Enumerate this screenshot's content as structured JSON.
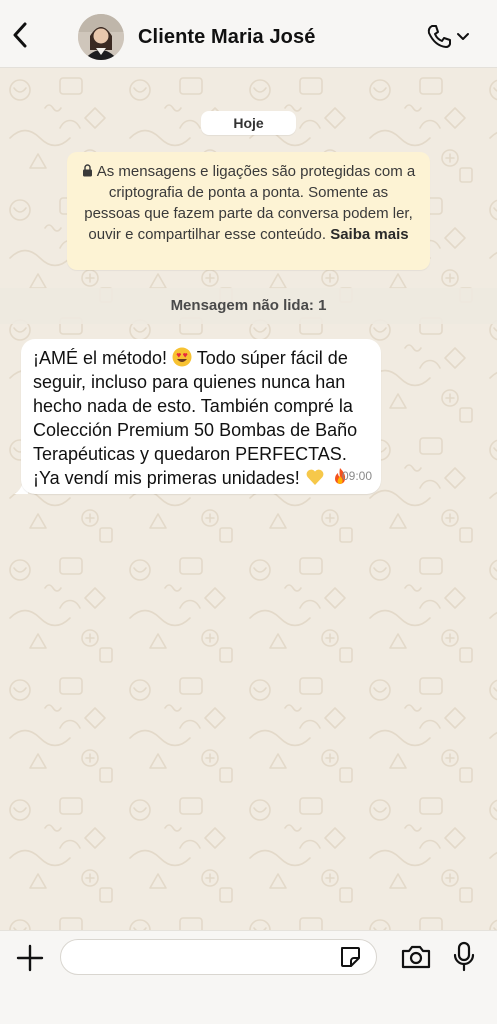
{
  "header": {
    "back_icon": "chevron-left-icon",
    "contact_name": "Cliente Maria José",
    "call_icon": "phone-icon",
    "call_menu_icon": "chevron-down-icon"
  },
  "chat": {
    "date_label": "Hoje",
    "encryption_notice": {
      "text": "As mensagens e ligações são protegidas com a criptografia de ponta a ponta. Somente as pessoas que fazem parte da conversa podem ler, ouvir e compartilhar esse conteúdo.",
      "link": "Saiba mais",
      "icon": "lock-icon"
    },
    "unread_label": "Mensagem não lida: 1",
    "messages": [
      {
        "part1": "¡AMÉ el método! ",
        "part2": " Todo súper fácil de seguir, incluso para quienes nunca han hecho nada de esto. También compré la Colección Premium 50 Bombas de Baño Terapéuticas y quedaron PERFECTAS. ¡Ya vendí mis primeras unidades! ",
        "emojis": [
          "heart-eyes-emoji",
          "yellow-heart-emoji",
          "fire-emoji"
        ],
        "time": "09:00"
      }
    ]
  },
  "composer": {
    "input_value": "",
    "plus_icon": "plus-icon",
    "sticker_icon": "sticker-icon",
    "camera_icon": "camera-icon",
    "mic_icon": "microphone-icon"
  },
  "colors": {
    "wallpaper": "#f1ebe1",
    "bubble": "#ffffff",
    "notice": "#fdf3d4",
    "header": "#f7f6f4"
  }
}
